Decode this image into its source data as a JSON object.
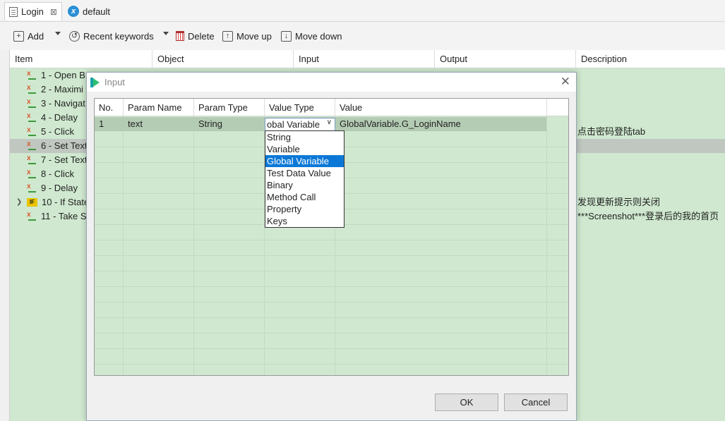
{
  "tabs": [
    {
      "label": "Login",
      "close": "⊠"
    },
    {
      "label": "default"
    }
  ],
  "toolbar": {
    "add": "Add",
    "recent": "Recent keywords",
    "delete": "Delete",
    "move_up": "Move up",
    "move_down": "Move down"
  },
  "table": {
    "headers": [
      "Item",
      "Object",
      "Input",
      "Output",
      "Description"
    ],
    "rows": [
      {
        "label": "1 - Open B",
        "desc": ""
      },
      {
        "label": "2 - Maximi",
        "desc": ""
      },
      {
        "label": "3 - Navigat",
        "desc": ""
      },
      {
        "label": "4 - Delay",
        "desc": ""
      },
      {
        "label": "5 - Click",
        "desc": "点击密码登陆tab"
      },
      {
        "label": "6 - Set Text",
        "desc": ""
      },
      {
        "label": "7 - Set Text",
        "desc": ""
      },
      {
        "label": "8 - Click",
        "desc": ""
      },
      {
        "label": "9 - Delay",
        "desc": ""
      },
      {
        "label": "10 - If State",
        "desc": "发现更新提示则关闭"
      },
      {
        "label": "11 - Take S",
        "desc": "***Screenshot***登录后的我的首页"
      }
    ]
  },
  "dialog": {
    "title": "Input",
    "columns": [
      "No.",
      "Param Name",
      "Param Type",
      "Value Type",
      "Value"
    ],
    "row": {
      "no": "1",
      "name": "text",
      "type": "String",
      "value_type": "obal Variable",
      "value": "GlobalVariable.G_LoginName"
    },
    "options": [
      "String",
      "Variable",
      "Global Variable",
      "Test Data Value",
      "Binary",
      "Method Call",
      "Property",
      "Keys"
    ],
    "selected_option": "Global Variable",
    "ok": "OK",
    "cancel": "Cancel"
  },
  "colors": {
    "row_green": "#cfe8cf",
    "selection_blue": "#0b78d7",
    "if_badge": "#e9c400"
  },
  "icons": [
    "doc-icon",
    "x-logo-icon",
    "add-icon",
    "history-icon",
    "trash-icon",
    "move-up-icon",
    "move-down-icon",
    "keyword-icon",
    "if-icon",
    "katalon-icon",
    "close-icon",
    "chevron-down-icon"
  ]
}
